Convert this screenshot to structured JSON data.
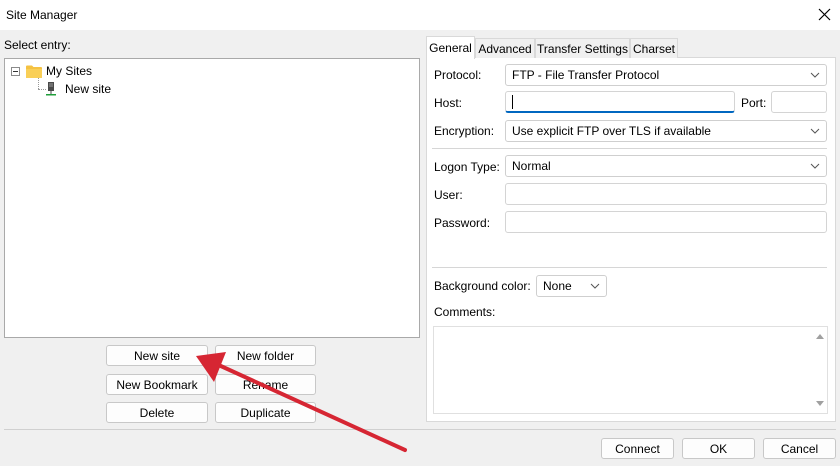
{
  "window": {
    "title": "Site Manager",
    "close_icon": "close-icon"
  },
  "left_panel": {
    "select_label": "Select entry:",
    "tree": {
      "root": {
        "label": "My Sites",
        "icon": "folder-icon",
        "expanded": true
      },
      "children": [
        {
          "label": "New site",
          "icon": "server-icon",
          "selected": true
        }
      ]
    },
    "buttons": {
      "new_site": "New site",
      "new_folder": "New folder",
      "new_bookmark": "New Bookmark",
      "rename": "Rename",
      "delete": "Delete",
      "duplicate": "Duplicate"
    }
  },
  "tabs": [
    {
      "label": "General",
      "active": true
    },
    {
      "label": "Advanced",
      "active": false
    },
    {
      "label": "Transfer Settings",
      "active": false
    },
    {
      "label": "Charset",
      "active": false
    }
  ],
  "general": {
    "protocol_label": "Protocol:",
    "protocol_value": "FTP - File Transfer Protocol",
    "host_label": "Host:",
    "host_value": "",
    "port_label": "Port:",
    "port_value": "",
    "encryption_label": "Encryption:",
    "encryption_value": "Use explicit FTP over TLS if available",
    "logon_type_label": "Logon Type:",
    "logon_type_value": "Normal",
    "user_label": "User:",
    "user_value": "",
    "password_label": "Password:",
    "password_value": "",
    "background_color_label": "Background color:",
    "background_color_value": "None",
    "comments_label": "Comments:",
    "comments_value": ""
  },
  "footer": {
    "connect": "Connect",
    "ok": "OK",
    "cancel": "Cancel"
  },
  "colors": {
    "accent": "#0067c0",
    "annotation_arrow": "#d62633",
    "folder": "#f5c242"
  }
}
